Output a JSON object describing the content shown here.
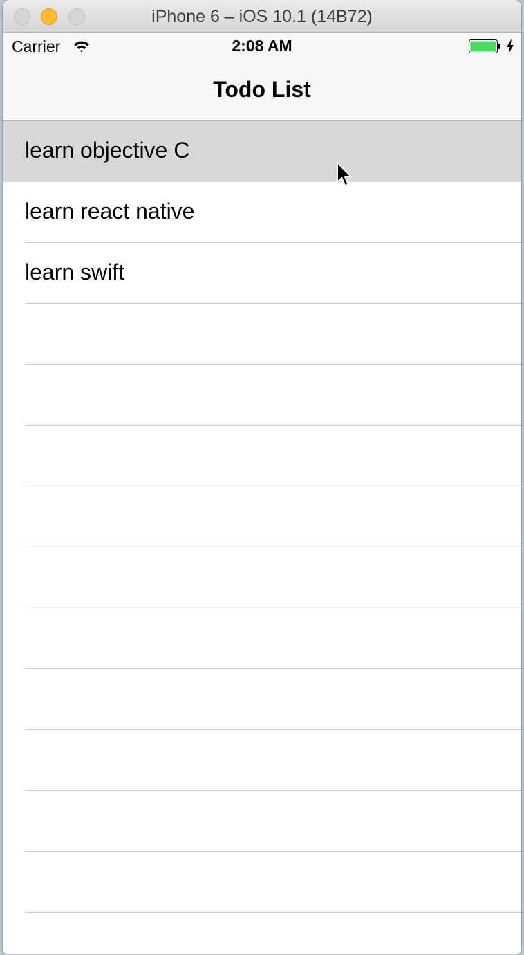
{
  "window": {
    "title": "iPhone 6 – iOS 10.1 (14B72)"
  },
  "status_bar": {
    "carrier": "Carrier",
    "time": "2:08 AM",
    "battery_color": "#4cd964",
    "icons": [
      "wifi-icon",
      "battery-icon",
      "charging-bolt-icon"
    ]
  },
  "nav_bar": {
    "title": "Todo List"
  },
  "todo_list": {
    "items": [
      {
        "label": "learn objective C",
        "selected": true
      },
      {
        "label": "learn react native",
        "selected": false
      },
      {
        "label": "learn swift",
        "selected": false
      }
    ],
    "selected_color": "#d8d8d8",
    "separator_color": "#c8c7cc"
  },
  "cursor": {
    "icon": "mouse-pointer-icon"
  }
}
